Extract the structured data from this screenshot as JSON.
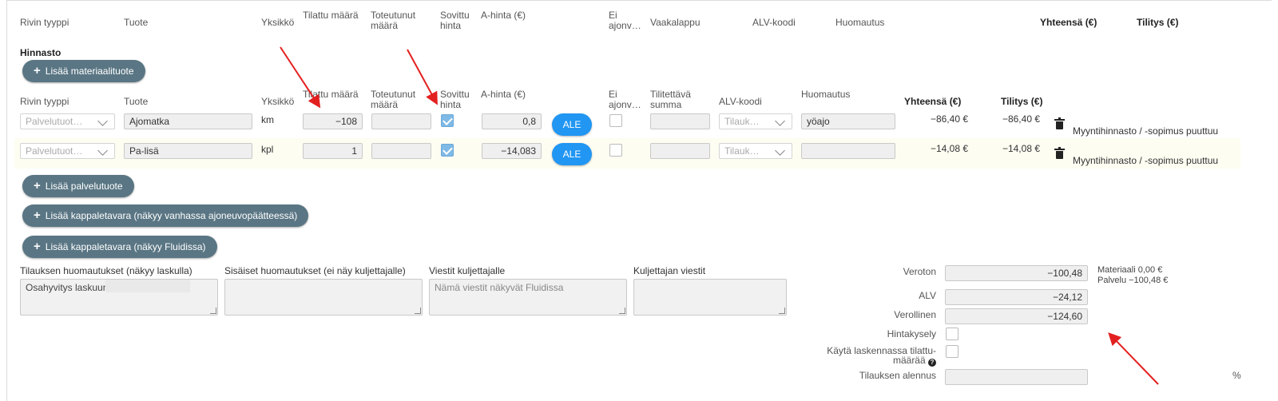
{
  "top_headers": {
    "rivin_tyyppi": "Rivin tyyppi",
    "tuote": "Tuote",
    "yksikko": "Yksikkö",
    "tilattu_maara": "Tilattu määrä",
    "toteutunut_1": "Toteutunut",
    "toteutunut_2": "määrä",
    "sovittu_1": "Sovittu",
    "sovittu_2": "hinta",
    "a_hinta": "A-hinta (€)",
    "ei_1": "Ei",
    "ei_2": "ajonv…",
    "vaakalappu": "Vaakalappu",
    "alv_koodi": "ALV-koodi",
    "huomautus": "Huomautus",
    "yhteensa": "Yhteensä (€)",
    "tilitys": "Tilitys (€)"
  },
  "hinnasto": {
    "title": "Hinnasto",
    "add_material": "Lisää materiaalituote"
  },
  "price_headers": {
    "rivin_tyyppi": "Rivin tyyppi",
    "tuote": "Tuote",
    "yksikko": "Yksikkö",
    "tilattu_maara": "Tilattu määrä",
    "toteutunut_1": "Toteutunut",
    "toteutunut_2": "määrä",
    "sovittu_1": "Sovittu",
    "sovittu_2": "hinta",
    "a_hinta": "A-hinta (€)",
    "ei_1": "Ei",
    "ei_2": "ajonv…",
    "tilitettava_1": "Tilitettävä",
    "tilitettava_2": "summa",
    "alv_koodi": "ALV-koodi",
    "huomautus": "Huomautus",
    "yhteensa": "Yhteensä (€)",
    "tilitys": "Tilitys (€)"
  },
  "rows": [
    {
      "type_placeholder": "Palvelutuot…",
      "product": "Ajomatka",
      "unit": "km",
      "ordered": "−108",
      "realized": "",
      "agreed_checked": true,
      "unit_price": "0,8",
      "ale": "ALE",
      "not_vehicle_checked": false,
      "settle_amount": "",
      "alv_placeholder": "Tilauk…",
      "note": "yöajo",
      "total": "−86,40 €",
      "settlement": "−86,40 €",
      "warning": "Myyntihinnasto / -sopimus puuttuu"
    },
    {
      "type_placeholder": "Palvelutuot…",
      "product": "Pa-lisä",
      "unit": "kpl",
      "ordered": "1",
      "realized": "",
      "agreed_checked": true,
      "unit_price": "−14,083",
      "ale": "ALE",
      "not_vehicle_checked": false,
      "settle_amount": "",
      "alv_placeholder": "Tilauk…",
      "note": "",
      "total": "−14,08 €",
      "settlement": "−14,08 €",
      "warning": "Myyntihinnasto / -sopimus puuttuu"
    }
  ],
  "buttons": {
    "add_service": "Lisää palvelutuote",
    "add_piece_old": "Lisää kappaletavara (näkyy vanhassa ajoneuvopäätteessä)",
    "add_piece_fluid": "Lisää kappaletavara (näkyy Fluidissa)"
  },
  "notes": {
    "invoice_label": "Tilauksen huomautukset (näkyy laskulla)",
    "invoice_value": "Osahyvitys laskuun",
    "internal_label": "Sisäiset huomautukset (ei näy kuljettajalle)",
    "internal_value": "",
    "driver_msg_label": "Viestit kuljettajalle",
    "driver_msg_placeholder": "Nämä viestit näkyvät Fluidissa",
    "from_driver_label": "Kuljettajan viestit",
    "from_driver_value": ""
  },
  "totals": {
    "veroton_label": "Veroton",
    "veroton_value": "−100,48",
    "materiaali": "Materiaali 0,00 €",
    "palvelu": "Palvelu −100,48 €",
    "alv_label": "ALV",
    "alv_value": "−24,12",
    "verollinen_label": "Verollinen",
    "verollinen_value": "−124,60",
    "hintakysely_label": "Hintakysely",
    "kayta_label_1": "Käytä laskennassa tilattu-",
    "kayta_label_2": "määrää",
    "alennus_label": "Tilauksen alennus",
    "alennus_value": "",
    "percent": "%"
  },
  "colors": {
    "accent_button": "#5a7684",
    "ale_button": "#2196f3",
    "checkbox_checked": "#7fb9e6",
    "arrow": "#e32020"
  }
}
